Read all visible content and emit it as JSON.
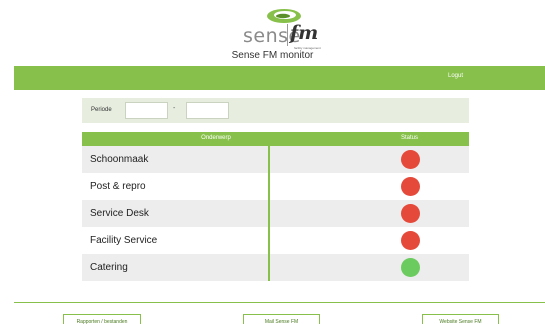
{
  "brand": {
    "name": "sense",
    "suffix": "fm",
    "tagline": "facility management",
    "app_title": "Sense FM monitor",
    "logo_icon": "swoosh-logo-icon"
  },
  "topbar": {
    "logout_label": "Logut"
  },
  "filter": {
    "label": "Periode",
    "from_value": "",
    "to_value": "",
    "separator": "-"
  },
  "table": {
    "headers": {
      "subject": "Onderwerp",
      "status": "Status"
    },
    "rows": [
      {
        "subject": "Schoonmaak",
        "status": "red"
      },
      {
        "subject": "Post & repro",
        "status": "red"
      },
      {
        "subject": "Service Desk",
        "status": "red"
      },
      {
        "subject": "Facility Service",
        "status": "red"
      },
      {
        "subject": "Catering",
        "status": "green"
      }
    ]
  },
  "colors": {
    "accent": "#87c04a",
    "status_red": "#e5493a",
    "status_green": "#6ccb5f"
  },
  "footer": {
    "buttons": [
      "Rapporten / bestanden",
      "Mail Sense FM",
      "Website Sense FM"
    ]
  }
}
